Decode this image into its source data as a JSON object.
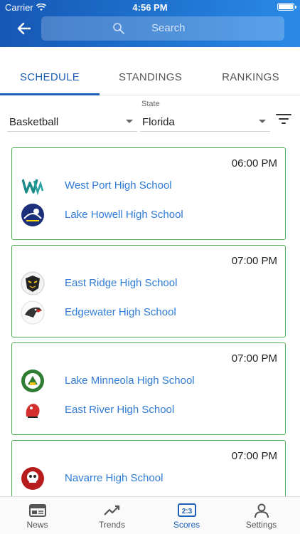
{
  "status_bar": {
    "carrier": "Carrier",
    "time": "4:56 PM"
  },
  "header": {
    "search_placeholder": "Search"
  },
  "tabs": [
    {
      "label": "SCHEDULE",
      "active": true
    },
    {
      "label": "STANDINGS",
      "active": false
    },
    {
      "label": "RANKINGS",
      "active": false
    }
  ],
  "filters": {
    "sport": "Basketball",
    "state_label": "State",
    "state": "Florida"
  },
  "games": [
    {
      "time": "06:00 PM",
      "home": "West Port High School",
      "away": "Lake Howell High School"
    },
    {
      "time": "07:00 PM",
      "home": "East Ridge High School",
      "away": "Edgewater High School"
    },
    {
      "time": "07:00 PM",
      "home": "Lake Minneola High School",
      "away": "East River High School"
    },
    {
      "time": "07:00 PM",
      "home": "Navarre High School",
      "away": ""
    }
  ],
  "tab_bar": [
    {
      "label": "News",
      "icon": "news-icon",
      "active": false
    },
    {
      "label": "Trends",
      "icon": "trends-icon",
      "active": false
    },
    {
      "label": "Scores",
      "icon": "scores-icon",
      "active": true
    },
    {
      "label": "Settings",
      "icon": "settings-icon",
      "active": false
    }
  ],
  "colors": {
    "header_start": "#1657b5",
    "header_end": "#2a8ae6",
    "accent": "#1c5fb6",
    "card_border": "#4caf50",
    "team_link": "#2f7bd6"
  }
}
